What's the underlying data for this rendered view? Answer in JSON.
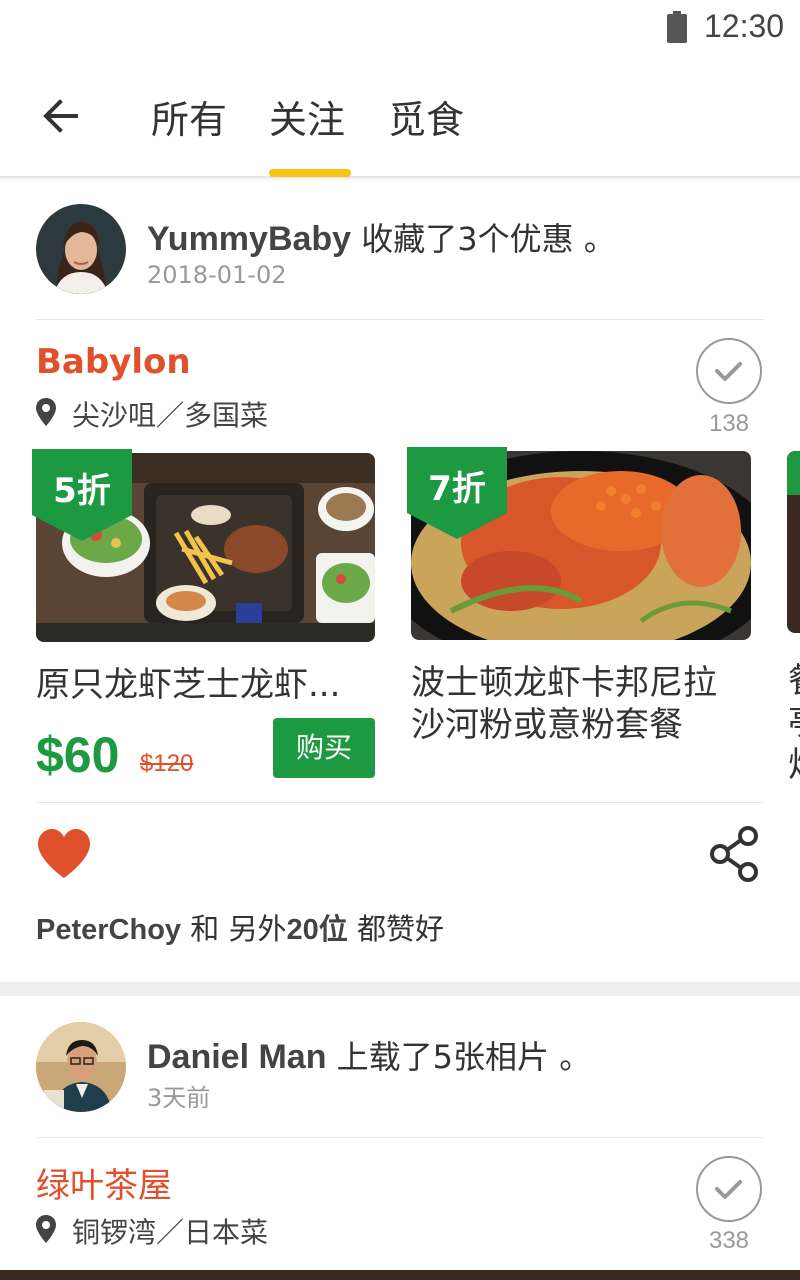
{
  "status_bar": {
    "time": "12:30"
  },
  "tabs": [
    {
      "label": "所有"
    },
    {
      "label": "关注"
    },
    {
      "label": "觅食"
    }
  ],
  "feed": [
    {
      "user": "YummyBaby",
      "action": "收藏了3个优惠 。",
      "time": "2018-01-02",
      "restaurant": {
        "name": "Babylon",
        "location": "尖沙咀／多国菜",
        "check_count": "138"
      },
      "deals": [
        {
          "discount": "5折",
          "name": "原只龙虾芝士龙虾...",
          "price": "$60",
          "original_price": "$120",
          "buy_label": "购买"
        },
        {
          "discount": "7折",
          "name_line1": "波士顿龙虾卡邦尼拉",
          "name_line2": "沙河粉或意粉套餐"
        },
        {
          "partial_chars": [
            "餐",
            "亭",
            "炽"
          ]
        }
      ],
      "likes": {
        "user": "PeterChoy",
        "text": " 和 另外",
        "count": "20位",
        "suffix": " 都赞好"
      }
    },
    {
      "user": "Daniel Man",
      "action": "上载了5张相片 。",
      "time": "3天前",
      "restaurant": {
        "name": "绿叶茶屋",
        "location": "铜锣湾／日本菜",
        "check_count": "338"
      }
    }
  ],
  "colors": {
    "accent_yellow": "#f7c415",
    "brand_green": "#1d9a41",
    "brand_orange": "#e0502b",
    "muted_text": "#999999"
  },
  "icons": [
    "battery-icon",
    "back-arrow-icon",
    "map-pin-icon",
    "check-icon",
    "heart-icon",
    "share-icon"
  ]
}
